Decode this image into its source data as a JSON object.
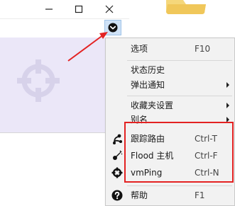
{
  "menu": {
    "items": [
      {
        "label": "选项",
        "shortcut": "F10",
        "has_submenu": false
      },
      {
        "label": "状态历史",
        "shortcut": "",
        "has_submenu": false
      },
      {
        "label": "弹出通知",
        "shortcut": "",
        "has_submenu": true
      },
      {
        "label": "收藏夹设置",
        "shortcut": "",
        "has_submenu": true
      },
      {
        "label": "别名",
        "shortcut": "",
        "has_submenu": true
      },
      {
        "label": "跟踪路由",
        "shortcut": "Ctrl-T",
        "icon": "traceroute-icon"
      },
      {
        "label": "Flood 主机",
        "shortcut": "Ctrl-F",
        "icon": "flood-icon"
      },
      {
        "label": "vmPing",
        "shortcut": "Ctrl-N",
        "icon": "vmping-icon"
      },
      {
        "label": "帮助",
        "shortcut": "F1",
        "icon": "help-icon"
      }
    ]
  },
  "colors": {
    "canvas_bg": "#ebe7f8",
    "menu_bg": "#f2f2f2",
    "highlight": "#e32222",
    "toggle_bg": "#cfe2f6",
    "folder": "#f5d77b"
  },
  "icons": {
    "minimize": "minimize-icon",
    "maximize": "maximize-icon",
    "close": "close-icon",
    "menu_toggle": "chevron-down-circle-icon",
    "watermark": "crosshair-icon",
    "folder": "folder-icon"
  }
}
